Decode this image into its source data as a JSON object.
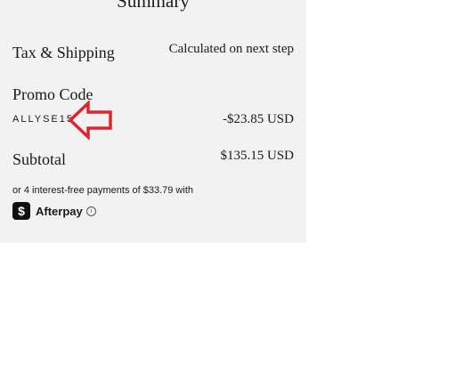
{
  "summary": {
    "heading": "Summary",
    "tax_shipping": {
      "label": "Tax & Shipping",
      "value": "Calculated on next step"
    },
    "promo": {
      "label": "Promo Code",
      "code": "ALLYSE15",
      "discount": "-$23.85 USD"
    },
    "subtotal": {
      "label": "Subtotal",
      "value": "$135.15 USD"
    },
    "afterpay": {
      "message": "or 4 interest-free payments of $33.79 with",
      "badge_symbol": "$",
      "brand": "Afterpay",
      "info_symbol": "i"
    }
  },
  "annotation": {
    "arrow_color": "#e0242f",
    "arrow_icon": "left-arrow-outline-icon"
  },
  "colors": {
    "panel_background": "#f2f2f2",
    "text": "#1a1a1a"
  }
}
